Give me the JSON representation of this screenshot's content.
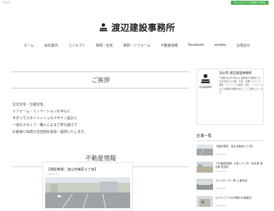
{
  "topbar": {
    "brand_small": "Read",
    "cta": "ホームページを無料で作成"
  },
  "site": {
    "title": "渡辺建設事務所"
  },
  "nav": {
    "items": [
      "ホーム",
      "会社案内",
      "コンセプト",
      "事例・住宅",
      "事例・リフォーム",
      "不動産情報",
      "Facebook",
      "ameba",
      "お問合せ"
    ]
  },
  "greeting": {
    "title": "ご挨拶",
    "lines": [
      "注文住宅・分譲住宅、",
      "リフォーム・リノベーションを中心に",
      "モダンでスタイリッシュなデザイン設計と",
      "一流のスタッフ・職人による丁寧な施工で",
      "お客様に快適な住空間を創造・提供いたします。"
    ]
  },
  "real_estate": {
    "title": "不動産情報",
    "card": {
      "title": "【貸駐車場：流山市美原２丁目】",
      "date": "2024/01/15"
    }
  },
  "sidebar": {
    "profile": {
      "name": "流山市 渡辺建設事務所",
      "logo_caption": "渡辺建設事務所",
      "desc": "千葉県流山市を拠点に建築設計事務所です。注文住宅から分譲、住宅・店舗・オフィス・施設・クリニックの設計・施工・リフォームなどお客様の理想を形にしてご提供いたします。"
    },
    "articles_head": "記事一覧",
    "articles": [
      {
        "title": "【貸駐車場：流山市美原２丁目】",
        "date": "2024/01/15"
      },
      {
        "title": "【不動産情報】土地１２１坪・柏木原 東谷新 駐詰町",
        "date": "2023/11/02"
      },
      {
        "title": "ゴルフセンター跡 工事完成",
        "date": "2023/09/20"
      },
      {
        "title": "モデルハウスの外観のお披露目",
        "date": "2023/08/10"
      }
    ]
  },
  "colors": {
    "cta": "#4caf50",
    "divider": "#d4d4d4"
  }
}
